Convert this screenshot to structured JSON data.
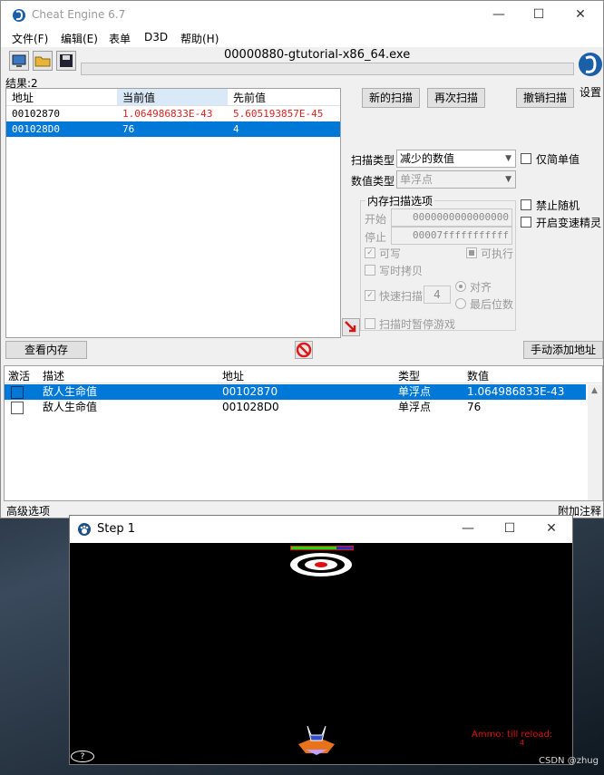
{
  "app": {
    "title": "Cheat Engine 6.7",
    "process": "00000880-gtutorial-x86_64.exe",
    "settings_label": "设置"
  },
  "window_controls": {
    "minimize": "—",
    "maximize": "☐",
    "close": "✕"
  },
  "menu": [
    "文件(F)",
    "编辑(E)",
    "表单",
    "D3D",
    "帮助(H)"
  ],
  "results": {
    "count_label": "结果:2",
    "columns": [
      "地址",
      "当前值",
      "先前值"
    ],
    "rows": [
      {
        "address": "00102870",
        "current": "1.064986833E-43",
        "previous": "5.605193857E-45"
      },
      {
        "address": "001028D0",
        "current": "76",
        "previous": "4"
      }
    ]
  },
  "scan_buttons": {
    "new": "新的扫描",
    "next": "再次扫描",
    "undo": "撤销扫描"
  },
  "scan_options": {
    "scan_type_label": "扫描类型",
    "scan_type_value": "减少的数值",
    "value_type_label": "数值类型",
    "value_type_value": "单浮点",
    "simple_only": "仅简单值",
    "mem_group": "内存扫描选项",
    "start_label": "开始",
    "start_value": "0000000000000000",
    "stop_label": "停止",
    "stop_value": "00007fffffffffff",
    "writable": "可写",
    "executable": "可执行",
    "copy_on_write": "写时拷贝",
    "fast_scan": "快速扫描",
    "fast_scan_value": "4",
    "align": "对齐",
    "last_digits": "最后位数",
    "pause_game": "扫描时暂停游戏",
    "no_random": "禁止随机",
    "speedhack": "开启变速精灵"
  },
  "mid_buttons": {
    "view_memory": "查看内存",
    "add_address": "手动添加地址"
  },
  "cheat_table": {
    "columns": [
      "激活",
      "描述",
      "地址",
      "类型",
      "数值"
    ],
    "rows": [
      {
        "desc": "敌人生命值",
        "address": "00102870",
        "type": "单浮点",
        "value": "1.064986833E-43"
      },
      {
        "desc": "敌人生命值",
        "address": "001028D0",
        "type": "单浮点",
        "value": "76"
      }
    ]
  },
  "status_bar": {
    "left": "高级选项",
    "right": "附加注释"
  },
  "game_window": {
    "title": "Step 1",
    "reload_text": "Ammo: till reload:",
    "reload_sub": "4",
    "help_glyph": "?"
  },
  "watermark": "CSDN @zhug",
  "colors": {
    "selection": "#0078d7",
    "red_value": "#e02020"
  }
}
